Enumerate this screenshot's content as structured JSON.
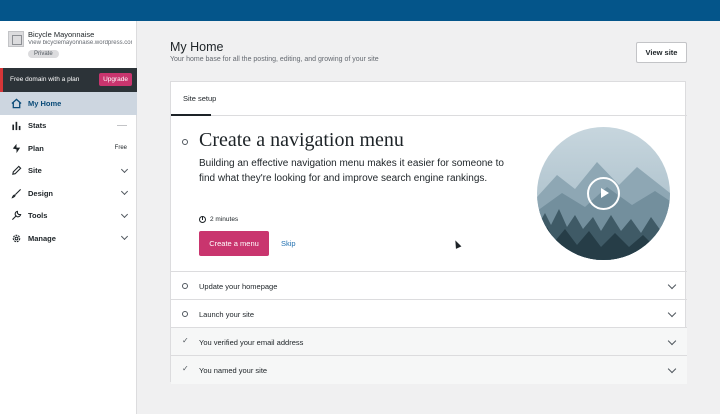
{
  "colors": {
    "topbar": "#04558a",
    "accent": "#c9356e",
    "link": "#2271b1",
    "active_nav_bg": "#cdd6e0"
  },
  "sidebar": {
    "site_name": "Bicycle Mayonnaise",
    "site_url": "View bicyclemayonnaise.wordpress.com",
    "privacy_badge": "Private",
    "domain_banner": {
      "text": "Free domain with a plan",
      "button_label": "Upgrade"
    },
    "items": [
      {
        "label": "My Home",
        "icon": "home-icon",
        "active": true
      },
      {
        "label": "Stats",
        "icon": "stats-icon"
      },
      {
        "label": "Plan",
        "icon": "plan-icon",
        "badge": "Free"
      },
      {
        "label": "Site",
        "icon": "pencil-icon"
      },
      {
        "label": "Design",
        "icon": "brush-icon"
      },
      {
        "label": "Tools",
        "icon": "wrench-icon"
      },
      {
        "label": "Manage",
        "icon": "gear-icon"
      }
    ]
  },
  "header": {
    "title": "My Home",
    "subtitle": "Your home base for all the posting, editing, and growing of your site",
    "view_site_label": "View site"
  },
  "site_setup": {
    "tab_label": "Site setup",
    "current_task": {
      "title": "Create a navigation menu",
      "description": "Building an effective navigation menu makes it easier for someone to find what they're looking for and improve search engine rankings.",
      "time": "2 minutes",
      "primary_button": "Create a menu",
      "skip_label": "Skip",
      "image_icon": "play-icon"
    },
    "tasks": [
      {
        "label": "Update your homepage",
        "status": "todo"
      },
      {
        "label": "Launch your site",
        "status": "todo"
      },
      {
        "label": "You verified your email address",
        "status": "done"
      },
      {
        "label": "You named your site",
        "status": "done"
      }
    ]
  }
}
